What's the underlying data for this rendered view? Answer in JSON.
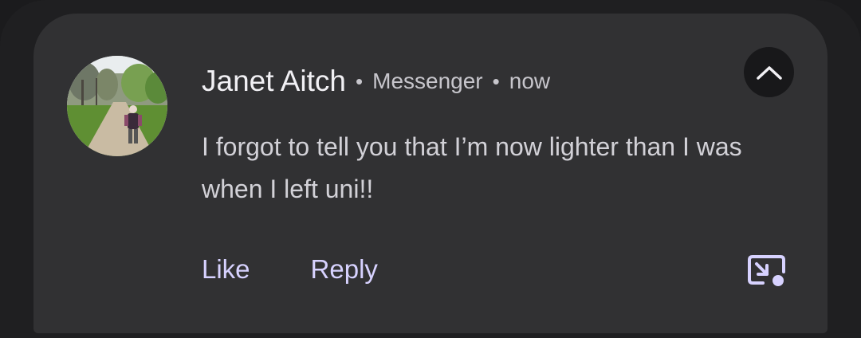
{
  "notification": {
    "sender": "Janet Aitch",
    "separator": "•",
    "app": "Messenger",
    "time": "now",
    "message": "I forgot to tell you that I’m now lighter than I was when I left uni!!",
    "actions": {
      "like": "Like",
      "reply": "Reply"
    },
    "icons": {
      "collapse": "chevron-up-icon",
      "bubble": "open-in-bubble-icon",
      "avatar": "contact-photo"
    },
    "colors": {
      "card_background": "#313133",
      "action_text": "#d7d2ff",
      "primary_text": "#f1f0f4"
    }
  }
}
